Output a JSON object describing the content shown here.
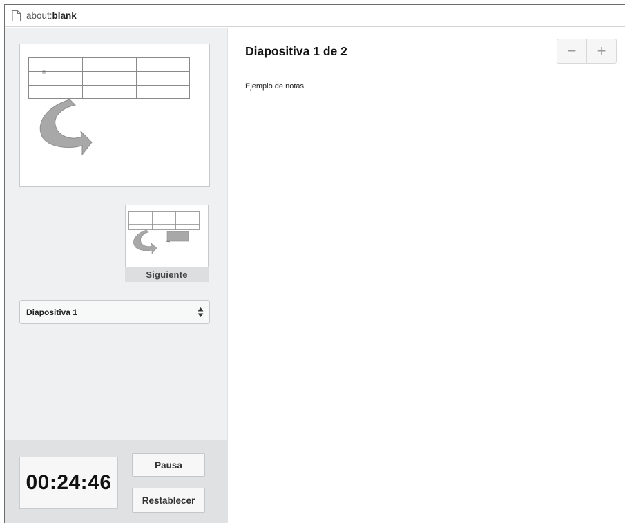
{
  "browser": {
    "url_prefix": "about:",
    "url_bold": "blank"
  },
  "left_panel": {
    "next_label": "Siguiente",
    "slide_select_value": "Diapositiva 1",
    "timer": "00:24:46",
    "pause_label": "Pausa",
    "reset_label": "Restablecer"
  },
  "right_panel": {
    "title": "Diapositiva 1 de 2",
    "zoom_out_label": "−",
    "zoom_in_label": "+",
    "notes": "Ejemplo de notas"
  },
  "icons": {
    "page": "page-icon",
    "updown": "up-down-arrows-icon",
    "curved_arrow": "curved-arrow-shape"
  },
  "colors": {
    "panel_bg": "#eef0f1",
    "bottom_bg": "#dfe1e2",
    "button_bg": "#f7f7f7",
    "arrow_gray": "#a8a8a8"
  }
}
